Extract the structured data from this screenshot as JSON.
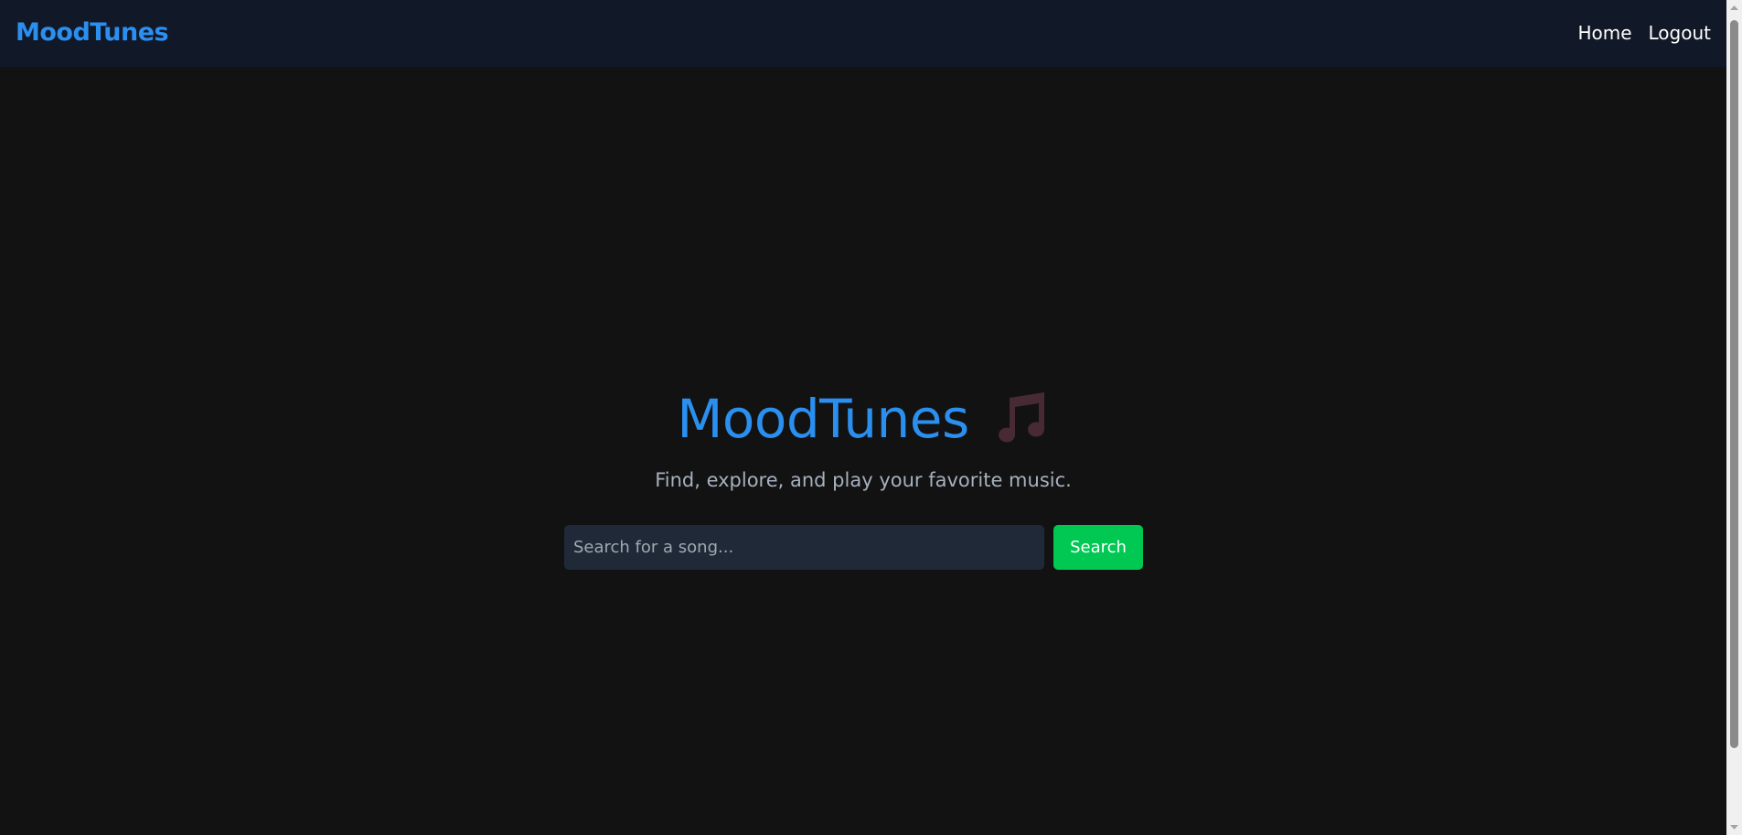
{
  "navbar": {
    "brand": "MoodTunes",
    "links": [
      {
        "label": "Home"
      },
      {
        "label": "Logout"
      }
    ]
  },
  "hero": {
    "title": "MoodTunes",
    "title_icon": "music-note-icon",
    "subtitle": "Find, explore, and play your favorite music."
  },
  "search": {
    "placeholder": "Search for a song...",
    "value": "",
    "button_label": "Search"
  },
  "colors": {
    "background": "#121212",
    "navbar_background": "#111827",
    "accent": "#2b8ff0",
    "button": "#00c853",
    "input_background": "#1f2937",
    "subtitle": "#a7b0be"
  }
}
